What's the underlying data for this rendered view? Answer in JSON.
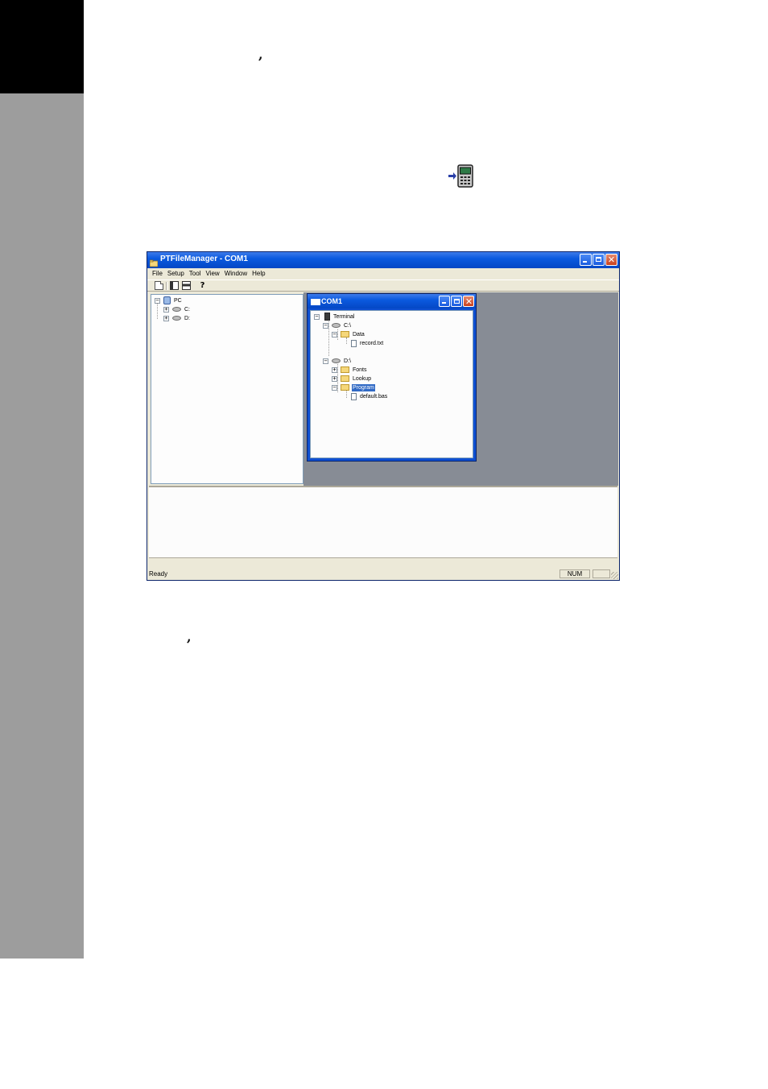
{
  "app": {
    "title": "PTFileManager - COM1",
    "menu": [
      "File",
      "Setup",
      "Tool",
      "View",
      "Window",
      "Help"
    ],
    "status": {
      "text": "Ready",
      "num_indicator": "NUM"
    }
  },
  "left_tree": {
    "root": "PC",
    "drives": [
      "C:",
      "D:"
    ]
  },
  "child_window": {
    "title": "COM1",
    "tree": {
      "root": "Terminal",
      "c_drive": "C:\\",
      "data_folder": "Data",
      "record_file": "record.txt",
      "d_drive": "D:\\",
      "fonts_folder": "Fonts",
      "lookup_folder": "Lookup",
      "program_folder": "Program",
      "default_file": "default.bas"
    }
  },
  "page": {
    "comma_top": ",",
    "comma_bottom": ","
  },
  "icons": {
    "connect": "terminal-connect-icon",
    "new": "new-document-icon",
    "help": "help-icon"
  }
}
